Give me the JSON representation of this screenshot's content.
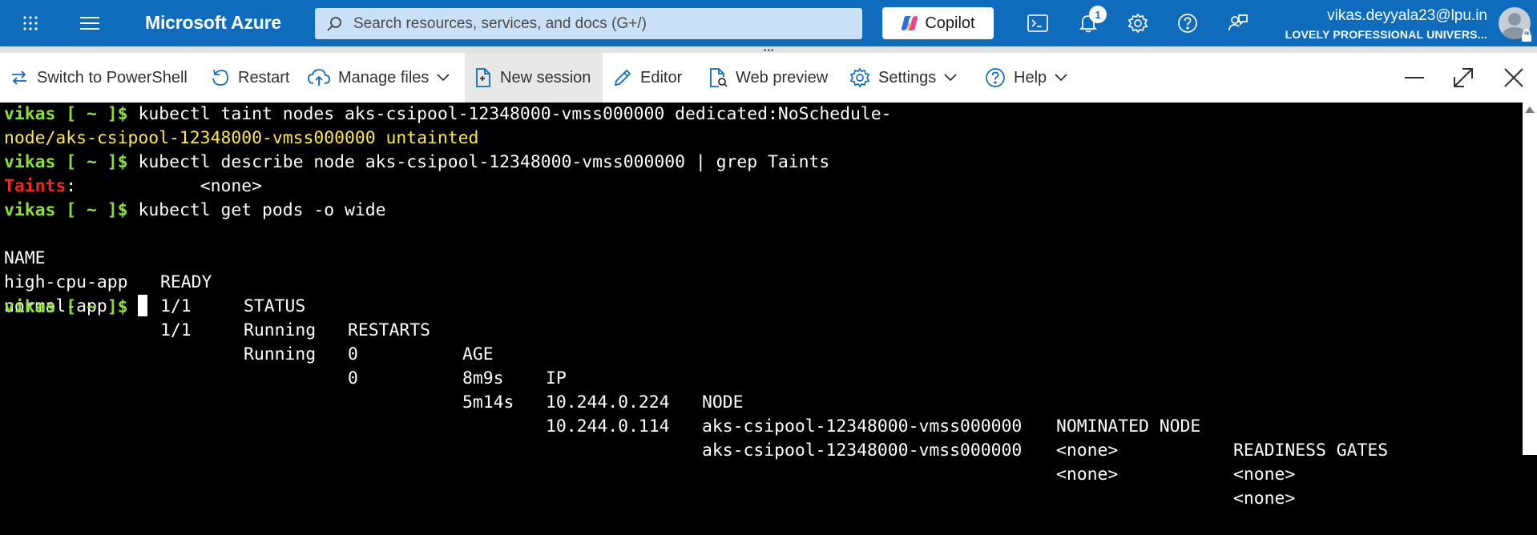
{
  "topbar": {
    "brand": "Microsoft Azure",
    "search_placeholder": "Search resources, services, and docs (G+/)",
    "copilot_label": "Copilot",
    "notification_count": "1",
    "user_email": "vikas.deyyala23@lpu.in",
    "user_org": "LOVELY PROFESSIONAL UNIVERS..."
  },
  "toolbar": {
    "switch_shell": "Switch to PowerShell",
    "restart": "Restart",
    "manage_files": "Manage files",
    "new_session": "New session",
    "editor": "Editor",
    "web_preview": "Web preview",
    "settings": "Settings",
    "help": "Help"
  },
  "terminal": {
    "prompt_user": "vikas",
    "prompt_path": " [ ~ ]$",
    "cmd1": " kubectl taint nodes aks-csipool-12348000-vmss000000 dedicated:NoSchedule-",
    "out1": "node/aks-csipool-12348000-vmss000000 untainted",
    "cmd2": " kubectl describe node aks-csipool-12348000-vmss000000 | grep Taints",
    "taints_key": "Taints",
    "taints_rest": ":            <none>",
    "cmd3": " kubectl get pods -o wide",
    "columns": [
      "NAME",
      "READY",
      "STATUS",
      "RESTARTS",
      "AGE",
      "IP",
      "NODE",
      "NOMINATED NODE",
      "READINESS GATES"
    ],
    "rows": [
      [
        "high-cpu-app",
        "1/1",
        "Running",
        "0",
        "8m9s",
        "10.244.0.224",
        "aks-csipool-12348000-vmss000000",
        "<none>",
        "<none>"
      ],
      [
        "normal-app",
        "1/1",
        "Running",
        "0",
        "5m14s",
        "10.244.0.114",
        "aks-csipool-12348000-vmss000000",
        "<none>",
        "<none>"
      ]
    ]
  },
  "colors": {
    "azure_blue": "#0f6cbd",
    "prompt_green": "#8ae234",
    "output_yellow": "#fce94f",
    "taints_red": "#ef2929"
  }
}
